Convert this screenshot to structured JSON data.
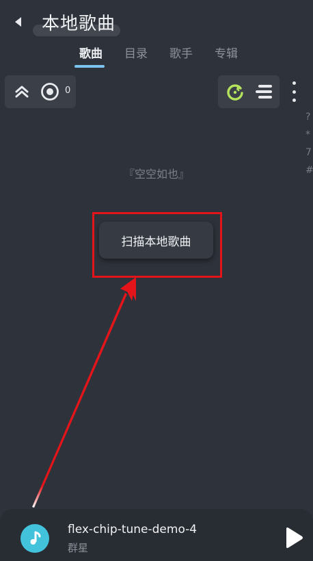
{
  "header": {
    "title": "本地歌曲",
    "back_icon": "back-arrow-icon"
  },
  "tabs": [
    {
      "label": "歌曲",
      "active": true
    },
    {
      "label": "目录",
      "active": false
    },
    {
      "label": "歌手",
      "active": false
    },
    {
      "label": "专辑",
      "active": false
    }
  ],
  "toolbar": {
    "collapse_icon": "double-chevron-up-icon",
    "locate_icon": "target-icon",
    "locate_count": "0",
    "refresh_icon": "refresh-icon",
    "sort_icon": "sort-lines-icon",
    "more_icon": "more-vertical-icon",
    "refresh_color": "#b5e35c"
  },
  "index_bar": [
    "?",
    "*",
    "7",
    "#"
  ],
  "main": {
    "empty_text": "『空空如也』",
    "scan_button_label": "扫描本地歌曲",
    "highlight_color": "#e3141a"
  },
  "player": {
    "title": "flex-chip-tune-demo-4",
    "artist": "群星",
    "cover_icon": "music-note-icon",
    "play_icon": "play-icon",
    "cover_color": "#43c2dc"
  }
}
